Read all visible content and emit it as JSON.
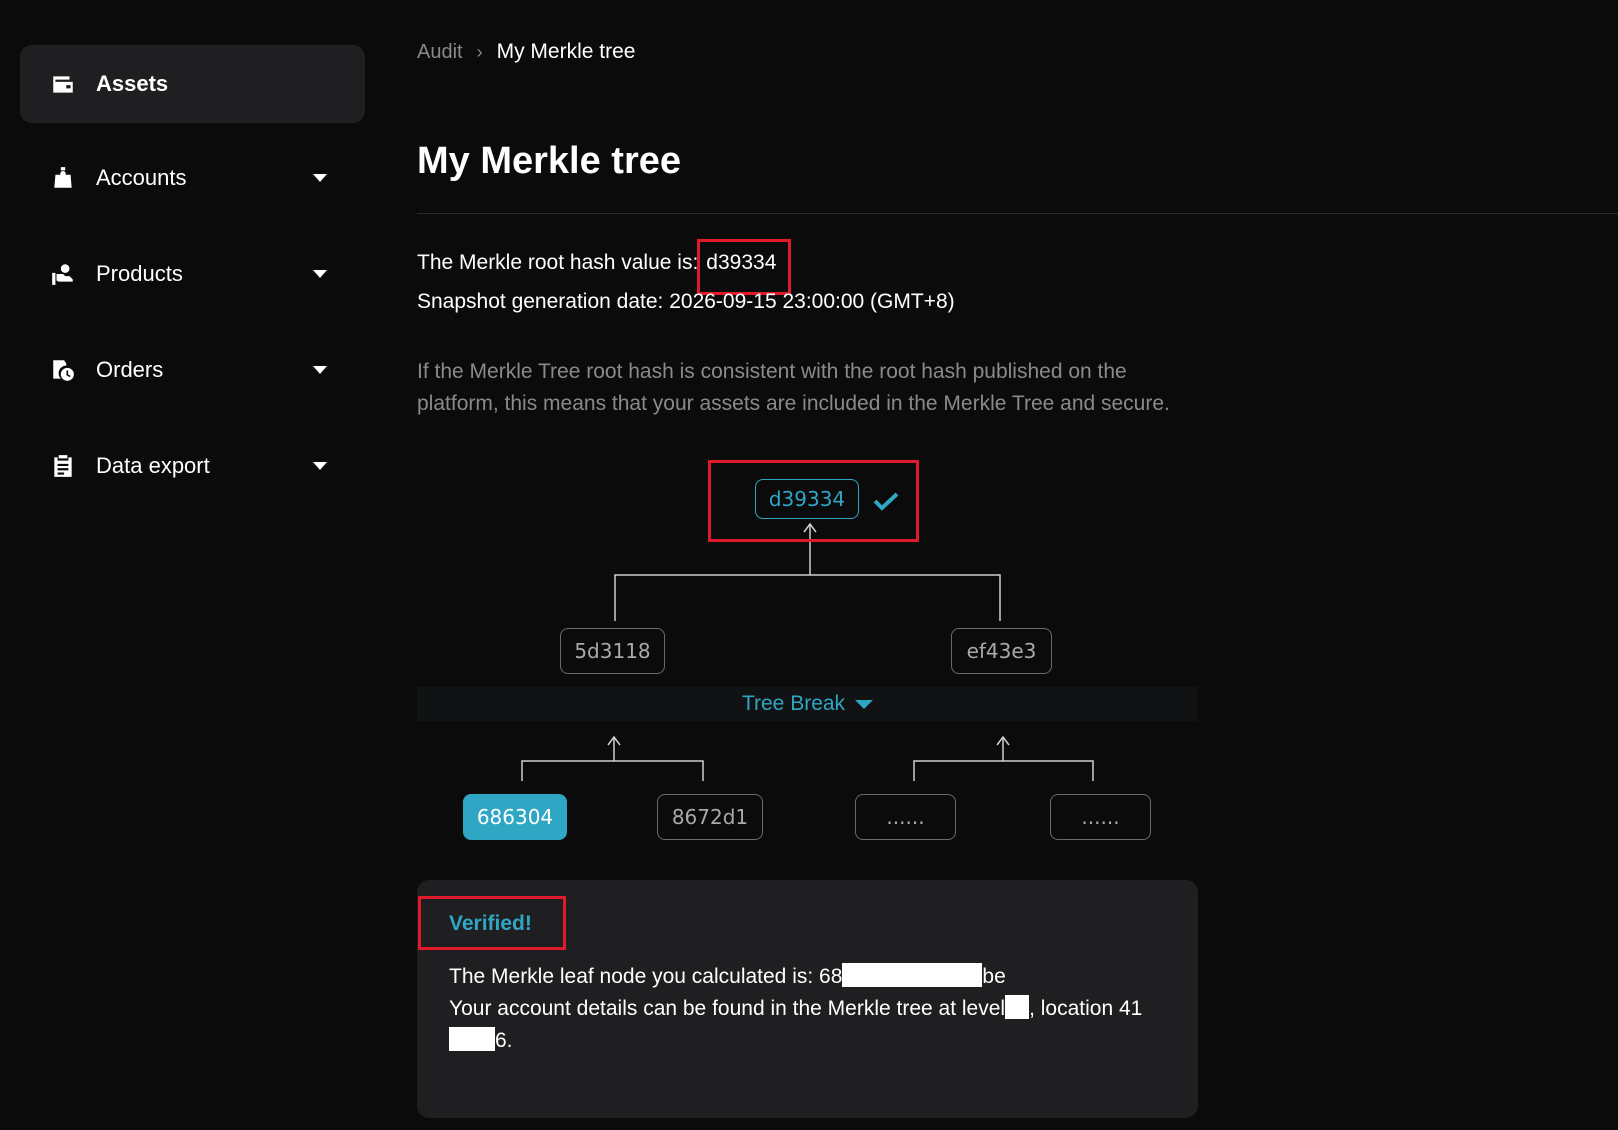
{
  "sidebar": {
    "items": [
      {
        "label": "Assets",
        "icon": "wallet-icon",
        "active": true
      },
      {
        "label": "Accounts",
        "icon": "user-icon"
      },
      {
        "label": "Products",
        "icon": "hand-coin-icon"
      },
      {
        "label": "Orders",
        "icon": "order-clock-icon"
      },
      {
        "label": "Data export",
        "icon": "clipboard-icon"
      }
    ]
  },
  "breadcrumb": {
    "parent": "Audit",
    "current": "My Merkle tree"
  },
  "page": {
    "title": "My Merkle tree"
  },
  "summary": {
    "root_label": "The Merkle root hash value is:",
    "root_hash": "d39334",
    "snapshot_label": "Snapshot generation date:",
    "snapshot_date": "2026-09-15 23:00:00 (GMT+8)"
  },
  "description": "If the Merkle Tree root hash is consistent with the root hash published on the platform, this means that your assets are included in the Merkle Tree and secure.",
  "tree": {
    "root": "d39334",
    "level1": [
      "5d3118",
      "ef43e3"
    ],
    "tree_break_label": "Tree Break",
    "leaves": [
      "686304",
      "8672d1",
      "......",
      "......"
    ]
  },
  "result": {
    "status": "Verified!",
    "leaf_prefix": "The Merkle leaf node you calculated is: 68",
    "leaf_suffix": "be",
    "location_prefix": "Your account details can be found in the Merkle tree at level",
    "location_mid": ", location",
    "location_num_start": "41",
    "location_num_end": "6."
  },
  "colors": {
    "accent": "#2fa6c4",
    "highlight": "#e0192b",
    "background": "#0b0b0c",
    "panel": "#1f1f21"
  }
}
